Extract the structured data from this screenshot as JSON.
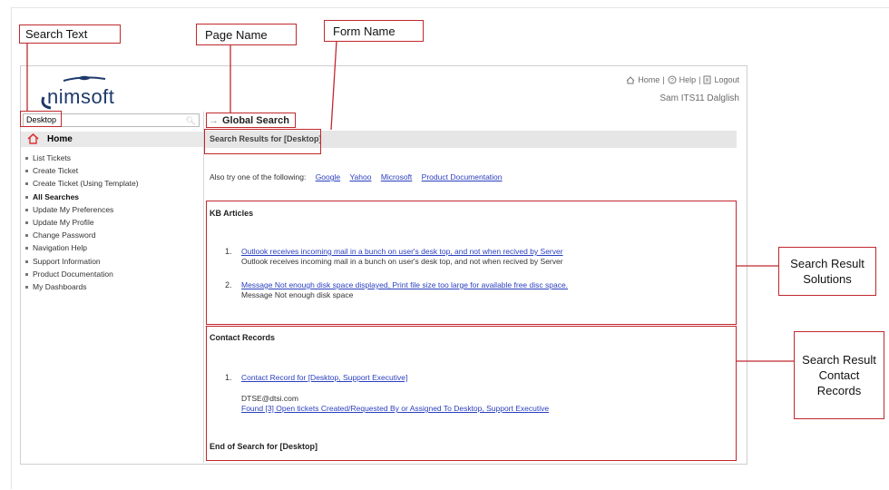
{
  "annotations": {
    "search_text": "Search Text",
    "page_name": "Page Name",
    "form_name": "Form Name",
    "search_result_solutions": "Search Result\nSolutions",
    "search_result_contact_records": "Search Result\nContact\nRecords"
  },
  "header": {
    "logo_text": "nimsoft",
    "links": [
      "Home",
      "Help",
      "Logout"
    ],
    "user": "Sam ITS11 Dalglish"
  },
  "sidebar": {
    "search_value": "Desktop",
    "home_label": "Home",
    "items": [
      {
        "label": "List Tickets",
        "bold": false
      },
      {
        "label": "Create Ticket",
        "bold": false
      },
      {
        "label": "Create Ticket (Using Template)",
        "bold": false
      },
      {
        "label": "All Searches",
        "bold": true
      },
      {
        "label": "Update My Preferences",
        "bold": false
      },
      {
        "label": "Update My Profile",
        "bold": false
      },
      {
        "label": "Change Password",
        "bold": false
      },
      {
        "label": "Navigation Help",
        "bold": false
      },
      {
        "label": "Support Information",
        "bold": false
      },
      {
        "label": "Product Documentation",
        "bold": false
      },
      {
        "label": "My Dashboards",
        "bold": false
      }
    ]
  },
  "main": {
    "page_title": "Global Search",
    "results_for": "Search Results for [Desktop]",
    "also_try_label": "Also try one of the following:",
    "also_try_links": [
      "Google",
      "Yahoo",
      "Microsoft",
      "Product Documentation"
    ],
    "kb": {
      "title": "KB Articles",
      "items": [
        {
          "num": "1.",
          "link": "Outlook receives incoming mail in a bunch on user's desk top, and not when recived by Server",
          "desc": "Outlook receives incoming mail in a bunch on user's desk top, and not when recived by Server"
        },
        {
          "num": "2.",
          "link": "Message Not enough disk space displayed, Print file size too large for available free disc space.",
          "desc": "Message Not enough disk space"
        }
      ]
    },
    "contacts": {
      "title": "Contact Records",
      "items": [
        {
          "num": "1.",
          "link": "Contact Record for [Desktop, Support Executive]",
          "email": "DTSE@dtsi.com",
          "found": "Found [3] Open tickets Created/Requested By or Assigned To Desktop, Support Executive"
        }
      ],
      "end_text": "End of Search for [Desktop]"
    }
  }
}
